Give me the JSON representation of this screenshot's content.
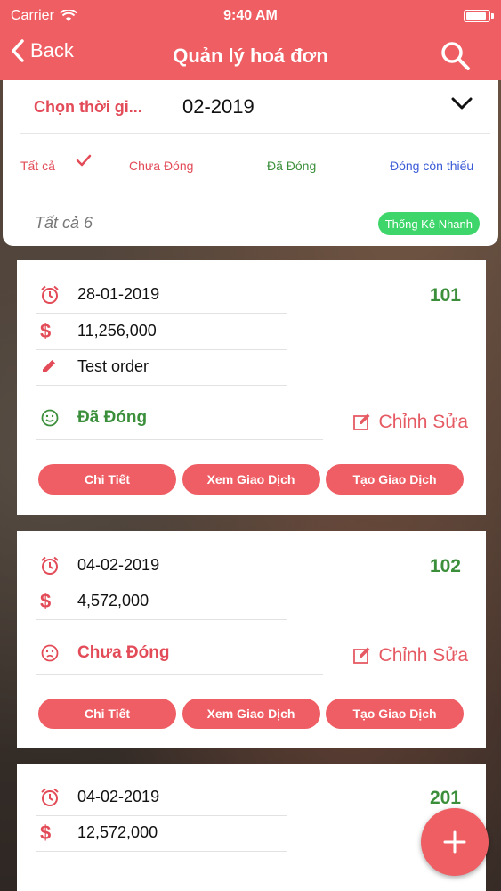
{
  "status_bar": {
    "carrier": "Carrier",
    "time": "9:40 AM"
  },
  "nav": {
    "back_label": "Back",
    "title": "Quản lý hoá đơn"
  },
  "filter": {
    "time_label": "Chọn thời gi...",
    "time_value": "02-2019",
    "tabs": [
      "Tất cả",
      "Chưa Đóng",
      "Đã Đóng",
      "Đóng còn thiếu"
    ],
    "selected_tab": "Tất cả",
    "summary": "Tất cả 6",
    "quick_stats_label": "Thống Kê Nhanh"
  },
  "cards": [
    {
      "date": "28-01-2019",
      "amount": "11,256,000",
      "note": "Test order",
      "status": "Đã Đóng",
      "order_number": "101",
      "edit_label": "Chỉnh Sửa"
    },
    {
      "date": "04-02-2019",
      "amount": "4,572,000",
      "status": "Chưa Đóng",
      "order_number": "102",
      "edit_label": "Chỉnh Sửa"
    },
    {
      "date": "04-02-2019",
      "amount": "12,572,000",
      "order_number": "201"
    }
  ],
  "actions": {
    "detail": "Chi Tiết",
    "view_transactions": "Xem Giao Dịch",
    "create_transaction": "Tạo Giao Dịch"
  },
  "icons": {
    "dollar": "$",
    "fab": "+"
  },
  "colors": {
    "brand": "#ef5e63",
    "paid": "#3b8f3b",
    "partial": "#3b5bd6",
    "quick_stats": "#3ed66a"
  }
}
